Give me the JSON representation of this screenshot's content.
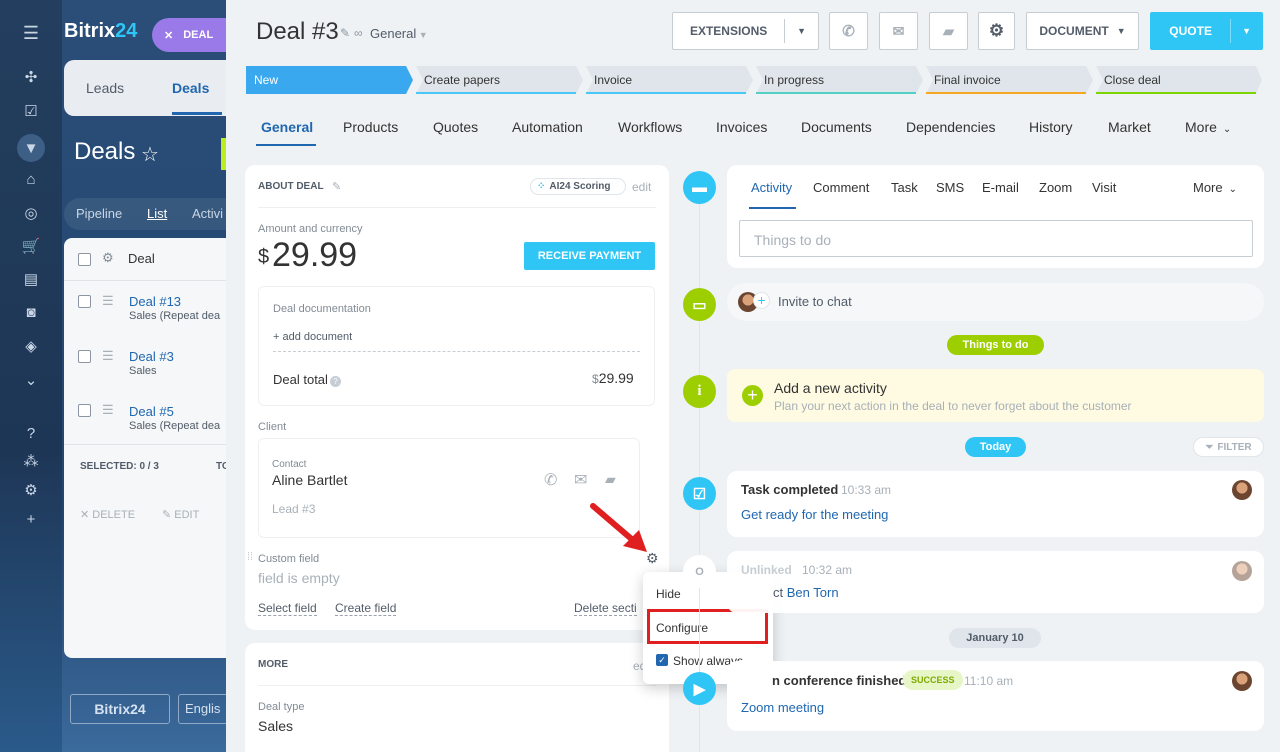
{
  "background": {
    "logo": "Bitrix",
    "logo_num": "24",
    "deal_pill": "DEAL",
    "tabs": [
      "Leads",
      "Deals"
    ],
    "heading": "Deals",
    "views": [
      "Pipeline",
      "List",
      "Activi"
    ],
    "col_deal": "Deal",
    "rows": [
      {
        "link": "Deal #13",
        "sub": "Sales (Repeat dea"
      },
      {
        "link": "Deal #3",
        "sub": "Sales"
      },
      {
        "link": "Deal #5",
        "sub": "Sales (Repeat dea"
      }
    ],
    "selected": "SELECTED: 0 / 3",
    "to": "TO",
    "delete": "DELETE",
    "edit": "EDIT",
    "footer_logo": "Bitrix24",
    "footer_lang": "Englis"
  },
  "header": {
    "title": "Deal #3",
    "category": "General",
    "extensions": "EXTENSIONS",
    "document": "DOCUMENT",
    "quote": "QUOTE"
  },
  "stages": [
    {
      "label": "New",
      "color": "#39a8ef"
    },
    {
      "label": "Create papers",
      "color": "#c7d2da"
    },
    {
      "label": "Invoice",
      "color": "#c7d2da"
    },
    {
      "label": "In progress",
      "color": "#c7d2da"
    },
    {
      "label": "Final invoice",
      "color": "#c7d2da"
    },
    {
      "label": "Close deal",
      "color": "#c7d2da"
    }
  ],
  "stage_underlines": [
    "#39a8ef",
    "#47c8f5",
    "#47c8f5",
    "#55d0c4",
    "#f5a623",
    "#7bd500"
  ],
  "tabs": [
    "General",
    "Products",
    "Quotes",
    "Automation",
    "Workflows",
    "Invoices",
    "Documents",
    "Dependencies",
    "History",
    "Market",
    "More"
  ],
  "about": {
    "title": "ABOUT DEAL",
    "scoring": "AI24 Scoring",
    "edit": "edit",
    "amount_label": "Amount and currency",
    "currency": "$",
    "amount": "29.99",
    "receive": "RECEIVE PAYMENT",
    "doc_label": "Deal documentation",
    "add_doc": "+ add document",
    "total_label": "Deal total",
    "total_currency": "$",
    "total_value": "29.99",
    "client_label": "Client",
    "contact_label": "Contact",
    "contact_name": "Aline Bartlet",
    "lead": "Lead #3",
    "custom_label": "Custom field",
    "custom_value": "field is empty",
    "select_field": "Select field",
    "create_field": "Create field",
    "delete_section": "Delete secti"
  },
  "more_card": {
    "title": "MORE",
    "edit": "ed",
    "deal_type_label": "Deal type",
    "deal_type": "Sales"
  },
  "context_menu": {
    "hide": "Hide",
    "configure": "Configure",
    "show_always": "Show always",
    "show_always_checked": true
  },
  "timeline": {
    "tabs": [
      "Activity",
      "Comment",
      "Task",
      "SMS",
      "E-mail",
      "Zoom",
      "Visit"
    ],
    "more": "More",
    "placeholder": "Things to do",
    "invite": "Invite to chat",
    "things_pill": "Things to do",
    "add_title": "Add a new activity",
    "add_sub": "Plan your next action in the deal to never forget about the customer",
    "today_pill": "Today",
    "filter": "FILTER",
    "task_title": "Task completed",
    "task_time": "10:33 am",
    "task_link": "Get ready for the meeting",
    "unlinked_title": "Unlinked",
    "unlinked_time": "10:32 am",
    "unlinked_prefix": "ct",
    "unlinked_link": "Ben Torn",
    "date_pill": "January 10",
    "zoom_title": "n conference finished",
    "zoom_badge": "SUCCESS",
    "zoom_time": "11:10 am",
    "zoom_link": "Zoom meeting"
  },
  "colors": {
    "accent": "#2fc6f6",
    "green": "#9dcf00",
    "link": "#2067b0",
    "red_highlight": "#e02020"
  }
}
